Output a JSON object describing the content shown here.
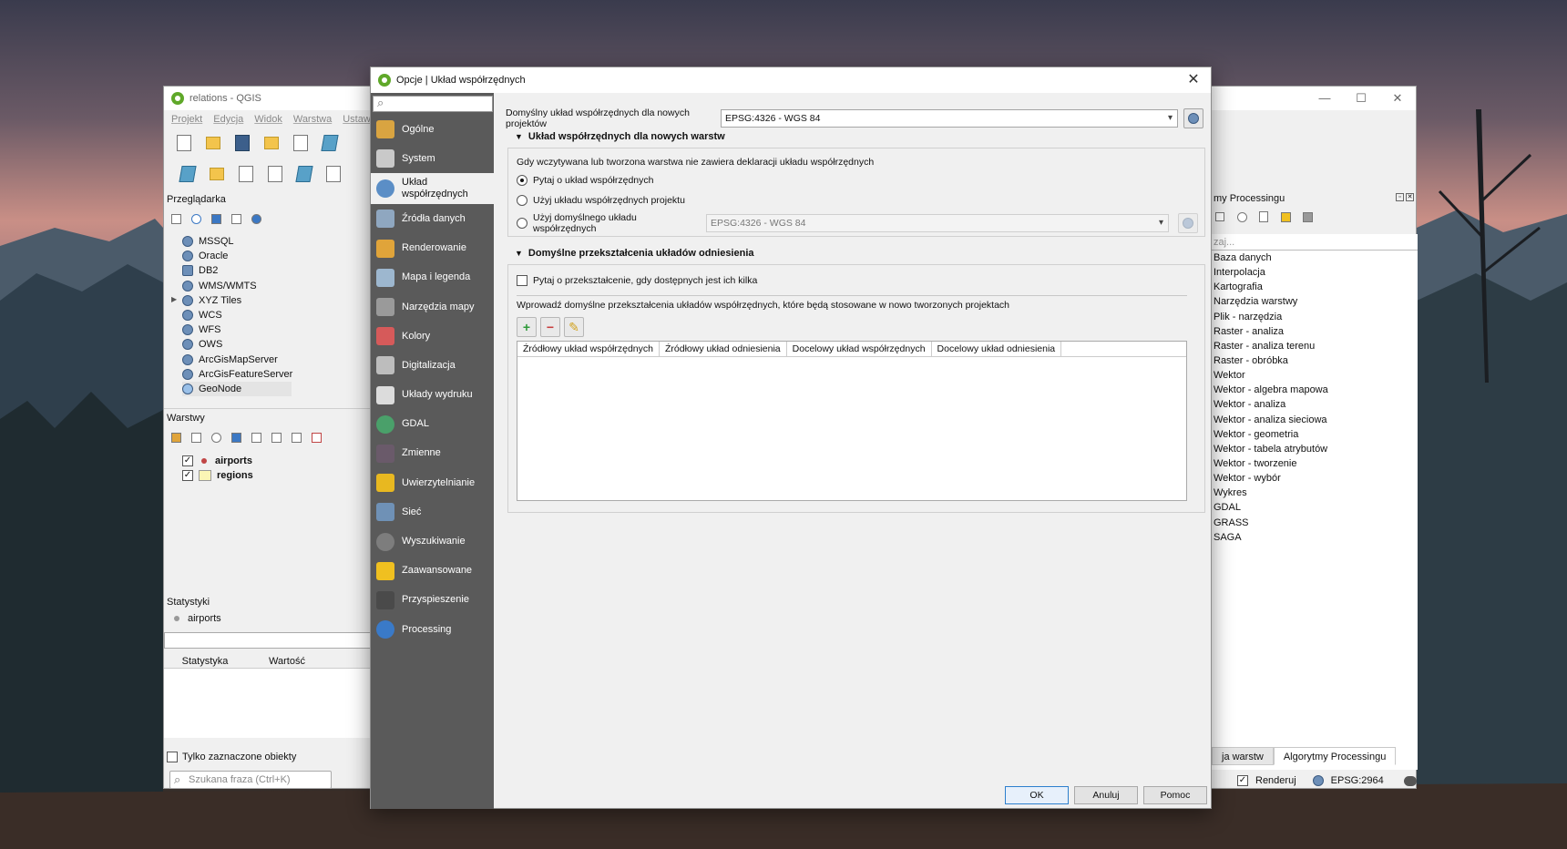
{
  "main_window": {
    "title": "relations - QGIS",
    "menu": [
      "Projekt",
      "Edycja",
      "Widok",
      "Warstwa",
      "Ustaw"
    ],
    "browser": {
      "title": "Przeglądarka",
      "items": [
        "MSSQL",
        "Oracle",
        "DB2",
        "WMS/WMTS",
        "XYZ Tiles",
        "WCS",
        "WFS",
        "OWS",
        "ArcGisMapServer",
        "ArcGisFeatureServer",
        "GeoNode"
      ]
    },
    "layers": {
      "title": "Warstwy",
      "items": [
        {
          "name": "airports",
          "checked": "✓"
        },
        {
          "name": "regions",
          "checked": "✓"
        }
      ]
    },
    "stats": {
      "title": "Statystyki",
      "layer": "airports",
      "col_stat": "Statystyka",
      "col_value": "Wartość",
      "only_selected": "Tylko zaznaczone obiekty",
      "search_placeholder": "Szukana fraza (Ctrl+K)"
    },
    "processing": {
      "title": "my Processingu",
      "filter_placeholder": "zaj...",
      "items": [
        "Baza danych",
        "Interpolacja",
        "Kartografia",
        "Narzędzia warstwy",
        "Plik - narzędzia",
        "Raster - analiza",
        "Raster - analiza terenu",
        "Raster - obróbka",
        "Wektor",
        "Wektor - algebra mapowa",
        "Wektor - analiza",
        "Wektor - analiza sieciowa",
        "Wektor - geometria",
        "Wektor - tabela atrybutów",
        "Wektor - tworzenie",
        "Wektor - wybór",
        "Wykres",
        "GDAL",
        "GRASS",
        "SAGA"
      ],
      "tabs": [
        "ja warstw",
        "Algorytmy Processingu"
      ]
    },
    "status": {
      "render_label": "Renderuj",
      "crs": "EPSG:2964"
    }
  },
  "dialog": {
    "title": "Opcje | Układ współrzędnych",
    "nav": [
      {
        "label": "Ogólne",
        "color": "#d9a441"
      },
      {
        "label": "System",
        "color": "#c9c9c9"
      },
      {
        "label": "Układ współrzędnych",
        "color": "#5b8ec6"
      },
      {
        "label": "Źródła danych",
        "color": "#8fa7c0"
      },
      {
        "label": "Renderowanie",
        "color": "#e0a43a"
      },
      {
        "label": "Mapa i legenda",
        "color": "#9db7cf"
      },
      {
        "label": "Narzędzia mapy",
        "color": "#9a9a9a"
      },
      {
        "label": "Kolory",
        "color": "#d65a5a"
      },
      {
        "label": "Digitalizacja",
        "color": "#bdbdbd"
      },
      {
        "label": "Układy wydruku",
        "color": "#dcdcdc"
      },
      {
        "label": "GDAL",
        "color": "#4aa06a"
      },
      {
        "label": "Zmienne",
        "color": "#6a5a6a"
      },
      {
        "label": "Uwierzytelnianie",
        "color": "#e8b820"
      },
      {
        "label": "Sieć",
        "color": "#6f91b6"
      },
      {
        "label": "Wyszukiwanie",
        "color": "#7d7d7d"
      },
      {
        "label": "Zaawansowane",
        "color": "#f0c020"
      },
      {
        "label": "Przyspieszenie",
        "color": "#4a4a4a"
      },
      {
        "label": "Processing",
        "color": "#3a7ac8"
      }
    ],
    "default_crs_label": "Domyślny układ współrzędnych dla nowych projektów",
    "default_crs_value": "EPSG:4326 - WGS 84",
    "new_layers": {
      "heading": "Układ współrzędnych dla nowych warstw",
      "description": "Gdy wczytywana lub tworzona warstwa nie zawiera deklaracji układu współrzędnych",
      "options": [
        "Pytaj o układ współrzędnych",
        "Użyj układu współrzędnych projektu",
        "Użyj domyślnego układu współrzędnych"
      ],
      "default_crs_value": "EPSG:4326 - WGS 84"
    },
    "transforms": {
      "heading": "Domyślne przekształcenia układów odniesienia",
      "ask_label": "Pytaj o przekształcenie, gdy dostępnych jest ich kilka",
      "intro": "Wprowadź domyślne przekształcenia układów współrzędnych, które będą stosowane w nowo tworzonych projektach",
      "columns": [
        "Źródłowy układ współrzędnych",
        "Źródłowy układ odniesienia",
        "Docelowy układ współrzędnych",
        "Docelowy układ odniesienia"
      ]
    },
    "buttons": {
      "ok": "OK",
      "cancel": "Anuluj",
      "help": "Pomoc"
    }
  }
}
